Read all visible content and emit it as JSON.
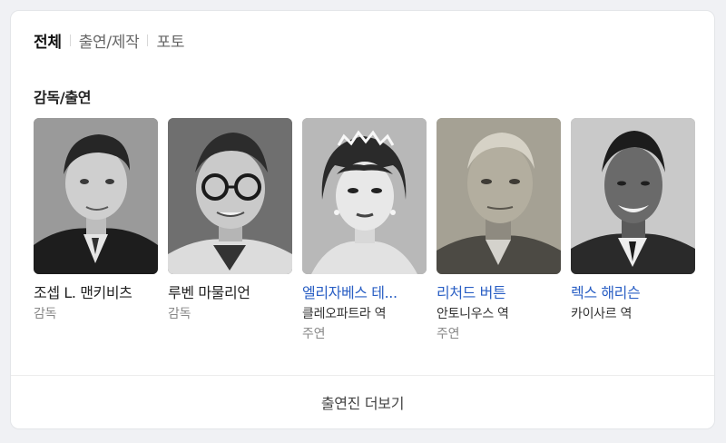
{
  "tabs": [
    {
      "label": "전체",
      "active": true
    },
    {
      "label": "출연/제작",
      "active": false
    },
    {
      "label": "포토",
      "active": false
    }
  ],
  "section_title": "감독/출연",
  "people": [
    {
      "name": "조셉 L. 맨키비츠",
      "role": "",
      "type": "감독",
      "linked": false,
      "photo_icon": "portrait-man-suit"
    },
    {
      "name": "루벤 마물리언",
      "role": "",
      "type": "감독",
      "linked": false,
      "photo_icon": "portrait-man-glasses"
    },
    {
      "name": "엘리자베스 테...",
      "role": "클레오파트라 역",
      "type": "주연",
      "linked": true,
      "photo_icon": "portrait-woman-tiara"
    },
    {
      "name": "리처드 버튼",
      "role": "안토니우스 역",
      "type": "주연",
      "linked": true,
      "photo_icon": "portrait-man-older"
    },
    {
      "name": "렉스 해리슨",
      "role": "카이사르 역",
      "type": "",
      "linked": true,
      "photo_icon": "portrait-man-smiling"
    }
  ],
  "more_label": "출연진 더보기",
  "colors": {
    "link": "#2a5fc4",
    "text": "#222222",
    "muted": "#888888",
    "background": "#f0f1f4"
  }
}
